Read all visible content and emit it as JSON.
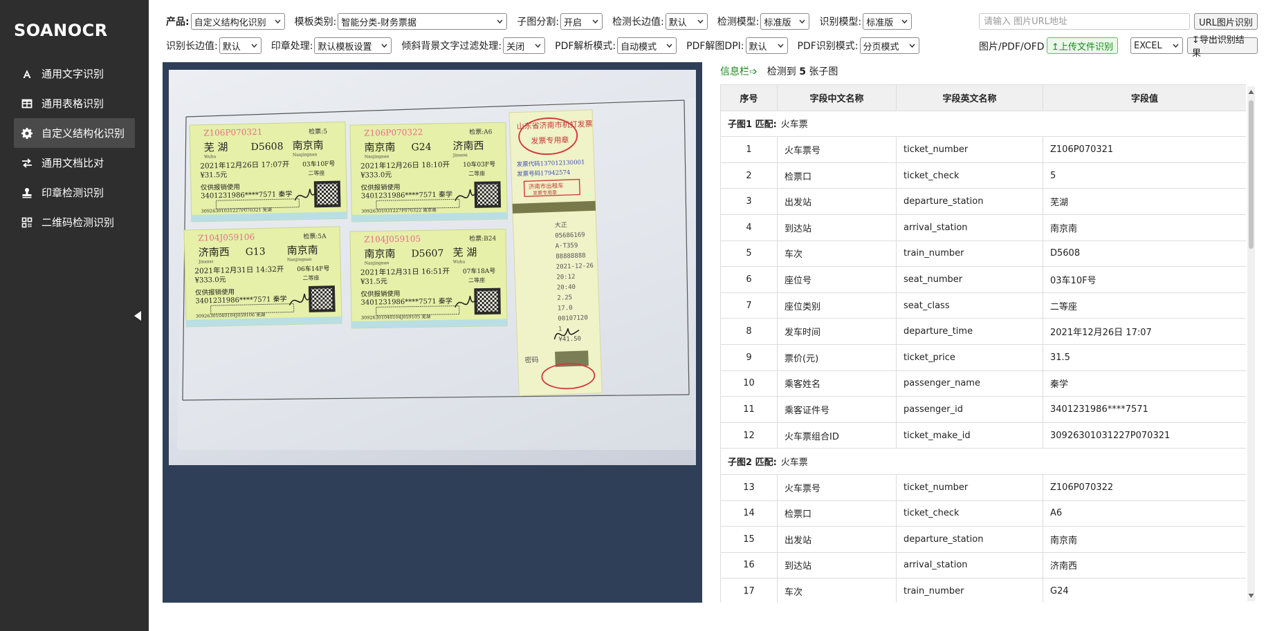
{
  "app": {
    "brand": "SOANOCR"
  },
  "sidebar": {
    "items": [
      {
        "label": "通用文字识别",
        "icon": "letter-a-icon"
      },
      {
        "label": "通用表格识别",
        "icon": "table-grid-icon"
      },
      {
        "label": "自定义结构化识别",
        "icon": "gear-icon",
        "active": true
      },
      {
        "label": "通用文档比对",
        "icon": "swap-arrows-icon"
      },
      {
        "label": "印章检测识别",
        "icon": "stamp-icon"
      },
      {
        "label": "二维码检测识别",
        "icon": "qr-code-icon"
      }
    ],
    "collapse_icon": "collapse-left-icon"
  },
  "toolbar": {
    "product": {
      "label": "产品:",
      "value": "自定义结构化识别"
    },
    "template": {
      "label": "模板类别:",
      "value": "智能分类-财务票据"
    },
    "split": {
      "label": "子图分割:",
      "value": "开启"
    },
    "detect_margin": {
      "label": "检测长边值:",
      "value": "默认"
    },
    "detect_model": {
      "label": "检测模型:",
      "value": "标准版"
    },
    "recog_model": {
      "label": "识别模型:",
      "value": "标准版"
    },
    "recog_margin": {
      "label": "识别长边值:",
      "value": "默认"
    },
    "seal": {
      "label": "印章处理:",
      "value": "默认模板设置"
    },
    "tilt": {
      "label": "倾斜背景文字过滤处理:",
      "value": "关闭"
    },
    "pdf_mode": {
      "label": "PDF解析模式:",
      "value": "自动模式"
    },
    "pdf_dpi": {
      "label": "PDF解图DPI:",
      "value": "默认"
    },
    "pdf_recog": {
      "label": "PDF识别模式:",
      "value": "分页模式"
    },
    "url_placeholder": "请输入 图片URL地址",
    "url_button": "URL图片识别",
    "file_label": "图片/PDF/OFD",
    "upload_button": "↥上传文件识别",
    "export_format": "EXCEL",
    "export_button": "↧导出识别结果"
  },
  "info": {
    "tag": "信息栏➩",
    "count_prefix": "检测到",
    "count": "5",
    "count_suffix": "张子图"
  },
  "table": {
    "headers": [
      "序号",
      "字段中文名称",
      "字段英文名称",
      "字段值"
    ],
    "groups": [
      {
        "key": "子图1 匹配:",
        "value": "火车票",
        "rows": [
          [
            "1",
            "火车票号",
            "ticket_number",
            "Z106P070321"
          ],
          [
            "2",
            "检票口",
            "ticket_check",
            "5"
          ],
          [
            "3",
            "出发站",
            "departure_station",
            "芜湖"
          ],
          [
            "4",
            "到达站",
            "arrival_station",
            "南京南"
          ],
          [
            "5",
            "车次",
            "train_number",
            "D5608"
          ],
          [
            "6",
            "座位号",
            "seat_number",
            "03车10F号"
          ],
          [
            "7",
            "座位类别",
            "seat_class",
            "二等座"
          ],
          [
            "8",
            "发车时间",
            "departure_time",
            "2021年12月26日 17:07"
          ],
          [
            "9",
            "票价(元)",
            "ticket_price",
            "31.5"
          ],
          [
            "10",
            "乘客姓名",
            "passenger_name",
            "秦学"
          ],
          [
            "11",
            "乘客证件号",
            "passenger_id",
            "3401231986****7571"
          ],
          [
            "12",
            "火车票组合ID",
            "ticket_make_id",
            "30926301031227P070321"
          ]
        ]
      },
      {
        "key": "子图2 匹配:",
        "value": "火车票",
        "rows": [
          [
            "13",
            "火车票号",
            "ticket_number",
            "Z106P070322"
          ],
          [
            "14",
            "检票口",
            "ticket_check",
            "A6"
          ],
          [
            "15",
            "出发站",
            "departure_station",
            "南京南"
          ],
          [
            "16",
            "到达站",
            "arrival_station",
            "济南西"
          ],
          [
            "17",
            "车次",
            "train_number",
            "G24"
          ]
        ]
      }
    ]
  },
  "photo": {
    "tickets": [
      {
        "id": "Z106P070321",
        "check": "检票:5",
        "from": "芜 湖",
        "from_py": "Wuhu",
        "train": "D5608",
        "to": "南京南",
        "to_py": "Nanjingnan",
        "date": "2021年12月26日 17:07开",
        "seat": "03车10F号",
        "price": "¥31.5元",
        "cls": "二等座",
        "note": "仅供报销使用",
        "pid": "3401231986****7571 秦学",
        "code": "30926301031227P070321  芜湖"
      },
      {
        "id": "Z106P070322",
        "check": "检票:A6",
        "from": "南京南",
        "from_py": "Nanjingnan",
        "train": "G24",
        "to": "济南西",
        "to_py": "Jinanxi",
        "date": "2021年12月26日 18:10开",
        "seat": "10车03F号",
        "price": "¥333.0元",
        "cls": "二等座",
        "note": "仅供报销使用",
        "pid": "3401231986****7571 秦学",
        "code": "30926301031227P070322  南京南"
      },
      {
        "id": "Z104J059106",
        "check": "检票:5A",
        "from": "济南西",
        "from_py": "Jinanxi",
        "train": "G13",
        "to": "南京南",
        "to_py": "Nanjingnan",
        "date": "2021年12月31日 14:32开",
        "seat": "06车14F号",
        "price": "¥333.0元",
        "cls": "二等座",
        "note": "仅供报销使用",
        "pid": "3401231986****7571 秦学",
        "code": "30926301040104J059106  芜湖"
      },
      {
        "id": "Z104J059105",
        "check": "检票:B24",
        "from": "南京南",
        "from_py": "Nanjingnan",
        "train": "D5607",
        "to": "芜 湖",
        "to_py": "Wuhu",
        "date": "2021年12月31日 16:51开",
        "seat": "07车18A号",
        "price": "¥31.5元",
        "cls": "二等座",
        "note": "仅供报销使用",
        "pid": "3401231986****7571 秦学",
        "code": "30926301040104J059105  芜湖"
      }
    ],
    "receipt": {
      "title": "山东省济南市机打发票",
      "stamp": "发票专用章",
      "code_line": "发票代码137012130001",
      "num_line": "发票号码17942574",
      "red_box": "济南市出租车",
      "red_sub": "发票专用章",
      "lines": [
        "大正",
        "05686169",
        "A·T359",
        "88888888",
        "2021-12-26",
        "20:12",
        "20:40",
        "2.25",
        "17.0",
        "00107120",
        "1",
        "¥41.50"
      ],
      "footer": "密码"
    }
  },
  "colors": {
    "sidebar_bg": "#2e2e2e",
    "image_panel_bg": "#2f3f58",
    "ticket_fill": "#e6f0a8",
    "accent_green": "#1b8a1b"
  }
}
